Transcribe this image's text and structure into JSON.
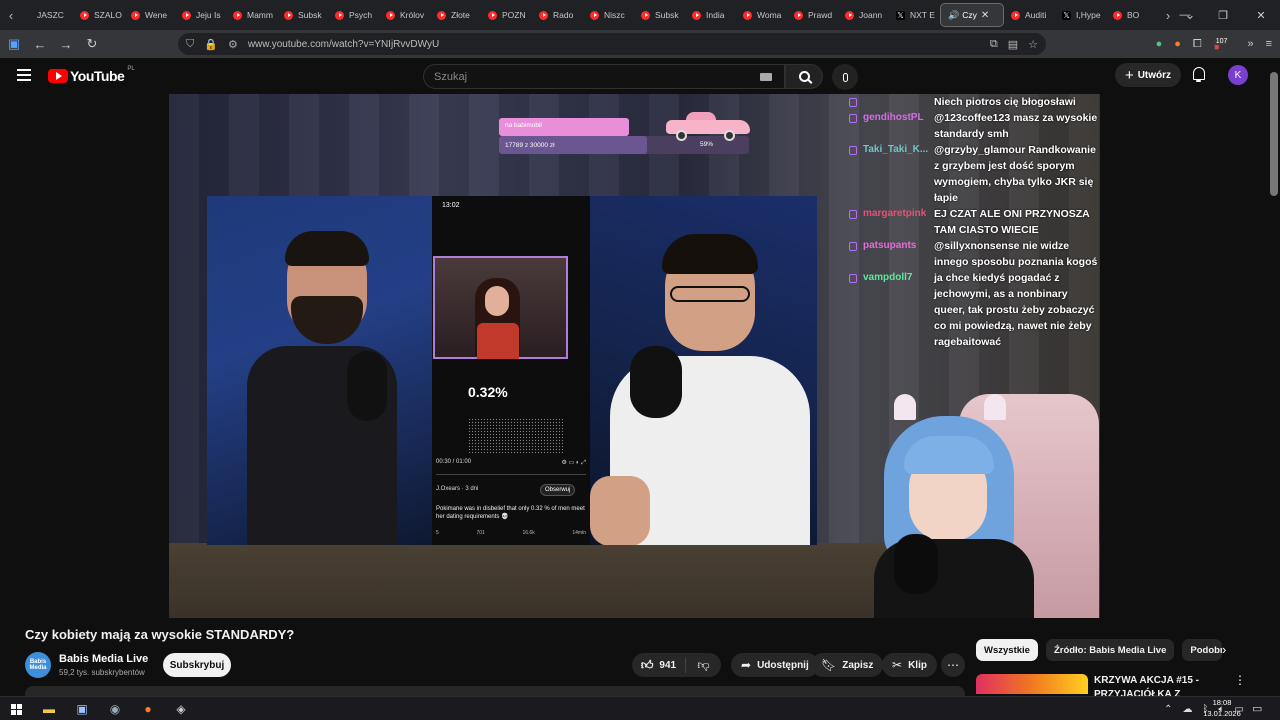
{
  "browser": {
    "tabs": [
      {
        "label": "JASZC",
        "icon": "none"
      },
      {
        "label": "SZALO",
        "icon": "youtube"
      },
      {
        "label": "Wene",
        "icon": "youtube"
      },
      {
        "label": "Jeju Is",
        "icon": "youtube"
      },
      {
        "label": "Mamm",
        "icon": "youtube"
      },
      {
        "label": "Subsk",
        "icon": "youtube"
      },
      {
        "label": "Psych",
        "icon": "youtube"
      },
      {
        "label": "Królov",
        "icon": "youtube"
      },
      {
        "label": "Złote",
        "icon": "youtube"
      },
      {
        "label": "POZN",
        "icon": "youtube"
      },
      {
        "label": "Rado",
        "icon": "youtube"
      },
      {
        "label": "Niszc",
        "icon": "youtube"
      },
      {
        "label": "Subsk",
        "icon": "youtube"
      },
      {
        "label": "India",
        "icon": "youtube"
      },
      {
        "label": "Woma",
        "icon": "youtube"
      },
      {
        "label": "Prawd",
        "icon": "youtube"
      },
      {
        "label": "Joann",
        "icon": "youtube"
      },
      {
        "label": "NXT E",
        "icon": "x"
      }
    ],
    "active_tab": {
      "label": "Czy",
      "close": "✕"
    },
    "tabs_after": [
      {
        "label": "Auditi",
        "icon": "youtube"
      },
      {
        "label": "I,Hype",
        "icon": "x"
      },
      {
        "label": "BO",
        "icon": "youtube"
      }
    ],
    "url": "www.youtube.com/watch?v=YNIjRvvDWyU",
    "extension_badge": "107"
  },
  "youtube": {
    "logo_text": "YouTube",
    "country_code": "PL",
    "search_placeholder": "Szukaj",
    "create_label": "Utwórz",
    "avatar_letter": "K",
    "accent": "#ff0000"
  },
  "stream": {
    "goal_label": "na babimobil",
    "goal_progress": "17789 z 30000 zł",
    "goal_percent": "59%",
    "goal_fraction": 0.59,
    "phone": {
      "time": "13:02",
      "stat": "0.32%",
      "video_time": "00:30 / 01:00",
      "handle": "J.Oxears · 3 dni",
      "follow": "Obserwuj",
      "caption": "Pokimane was in disbelief that only 0.32 % of men meet her dating requirements 💀",
      "actions": [
        "5",
        "701",
        "16.6k",
        "14mln"
      ]
    },
    "chat": [
      {
        "user": "",
        "color": "#c9a0ff",
        "message": "Niech piotros cię błogosławi"
      },
      {
        "user": "gendihostPL",
        "color": "#d66be8",
        "message": "@123coffee123 masz za wysokie standardy smh"
      },
      {
        "user": "Taki_Taki_K...",
        "color": "#6ec6c8",
        "message": "@grzyby_glamour Randkowanie z grzybem jest dość sporym wymogiem, chyba tylko JKR się łapie"
      },
      {
        "user": "margaretpink",
        "color": "#e8507a",
        "message": "EJ CZAT ALE ONI PRZYNOSZA TAM CIASTO WIECIE"
      },
      {
        "user": "patsupants",
        "color": "#e86ad9",
        "message": "@sillyxnonsense nie widze innego sposobu poznania kogoś"
      },
      {
        "user": "vampdoll7",
        "color": "#5fe89a",
        "message": "ja chce kiedyś pogadać z jechowymi, as a nonbinary queer, tak prostu żeby zobaczyć co mi powiedzą, nawet nie żeby ragebaitować"
      }
    ]
  },
  "video": {
    "title": "Czy kobiety mają za wysokie STANDARDY?",
    "channel": "Babis Media Live",
    "channel_avatar_text": "Babis Media",
    "subscribers": "59,2 tys. subskrybentów",
    "subscribe_label": "Subskrybuj",
    "likes": "941",
    "share_label": "Udostępnij",
    "save_label": "Zapisz",
    "clip_label": "Klip"
  },
  "sidebar": {
    "chips": [
      "Wszystkie",
      "Źródło: Babis Media Live",
      "Podobne"
    ],
    "rec_title": "KRZYWA AKCJA #15 - PRZYJACIÓŁKA Z"
  },
  "taskbar": {
    "time": "18:08",
    "date": "13.01.2026"
  }
}
